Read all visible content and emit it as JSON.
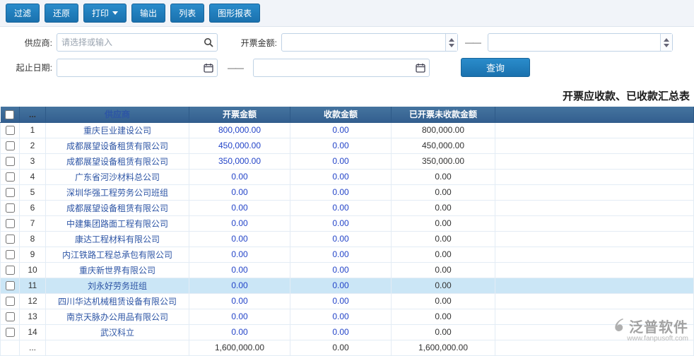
{
  "toolbar": {
    "buttons": [
      {
        "label": "过滤"
      },
      {
        "label": "还原"
      },
      {
        "label": "打印",
        "has_caret": true
      },
      {
        "label": "输出"
      },
      {
        "label": "列表"
      },
      {
        "label": "图形报表"
      }
    ]
  },
  "filters": {
    "supplier_label": "供应商:",
    "supplier_placeholder": "请选择或输入",
    "invoice_amount_label": "开票金额:",
    "date_label": "起止日期:",
    "range_separator": "——",
    "query_button": "查询"
  },
  "report": {
    "title": "开票应收款、已收款汇总表"
  },
  "table": {
    "columns": [
      "",
      "...",
      "供应商",
      "开票金额",
      "收款金额",
      "已开票未收款金额",
      ""
    ],
    "rows": [
      {
        "num": "1",
        "supplier": "重庆巨业建设公司",
        "invoice": "800,000.00",
        "received": "0.00",
        "unreceived": "800,000.00"
      },
      {
        "num": "2",
        "supplier": "成都展望设备租赁有限公司",
        "invoice": "450,000.00",
        "received": "0.00",
        "unreceived": "450,000.00"
      },
      {
        "num": "3",
        "supplier": "成都展望设备租赁有限公司",
        "invoice": "350,000.00",
        "received": "0.00",
        "unreceived": "350,000.00"
      },
      {
        "num": "4",
        "supplier": "广东省河沙材料总公司",
        "invoice": "0.00",
        "received": "0.00",
        "unreceived": "0.00"
      },
      {
        "num": "5",
        "supplier": "深圳华强工程劳务公司班组",
        "invoice": "0.00",
        "received": "0.00",
        "unreceived": "0.00"
      },
      {
        "num": "6",
        "supplier": "成都展望设备租赁有限公司",
        "invoice": "0.00",
        "received": "0.00",
        "unreceived": "0.00"
      },
      {
        "num": "7",
        "supplier": "中建集团路面工程有限公司",
        "invoice": "0.00",
        "received": "0.00",
        "unreceived": "0.00"
      },
      {
        "num": "8",
        "supplier": "康达工程材料有限公司",
        "invoice": "0.00",
        "received": "0.00",
        "unreceived": "0.00"
      },
      {
        "num": "9",
        "supplier": "内江铁路工程总承包有限公司",
        "invoice": "0.00",
        "received": "0.00",
        "unreceived": "0.00"
      },
      {
        "num": "10",
        "supplier": "重庆新世界有限公司",
        "invoice": "0.00",
        "received": "0.00",
        "unreceived": "0.00"
      },
      {
        "num": "11",
        "supplier": "刘永好劳务班组",
        "invoice": "0.00",
        "received": "0.00",
        "unreceived": "0.00",
        "highlighted": true
      },
      {
        "num": "12",
        "supplier": "四川华达机械租赁设备有限公司",
        "invoice": "0.00",
        "received": "0.00",
        "unreceived": "0.00"
      },
      {
        "num": "13",
        "supplier": "南京天脉办公用品有限公司",
        "invoice": "0.00",
        "received": "0.00",
        "unreceived": "0.00"
      },
      {
        "num": "14",
        "supplier": "武汉科立",
        "invoice": "0.00",
        "received": "0.00",
        "unreceived": "0.00"
      }
    ],
    "footer": {
      "num": "...",
      "supplier": "",
      "invoice": "1,600,000.00",
      "received": "0.00",
      "unreceived": "1,600,000.00"
    }
  },
  "watermark": {
    "brand": "泛普软件",
    "url": "www.fanpusoft.com"
  }
}
